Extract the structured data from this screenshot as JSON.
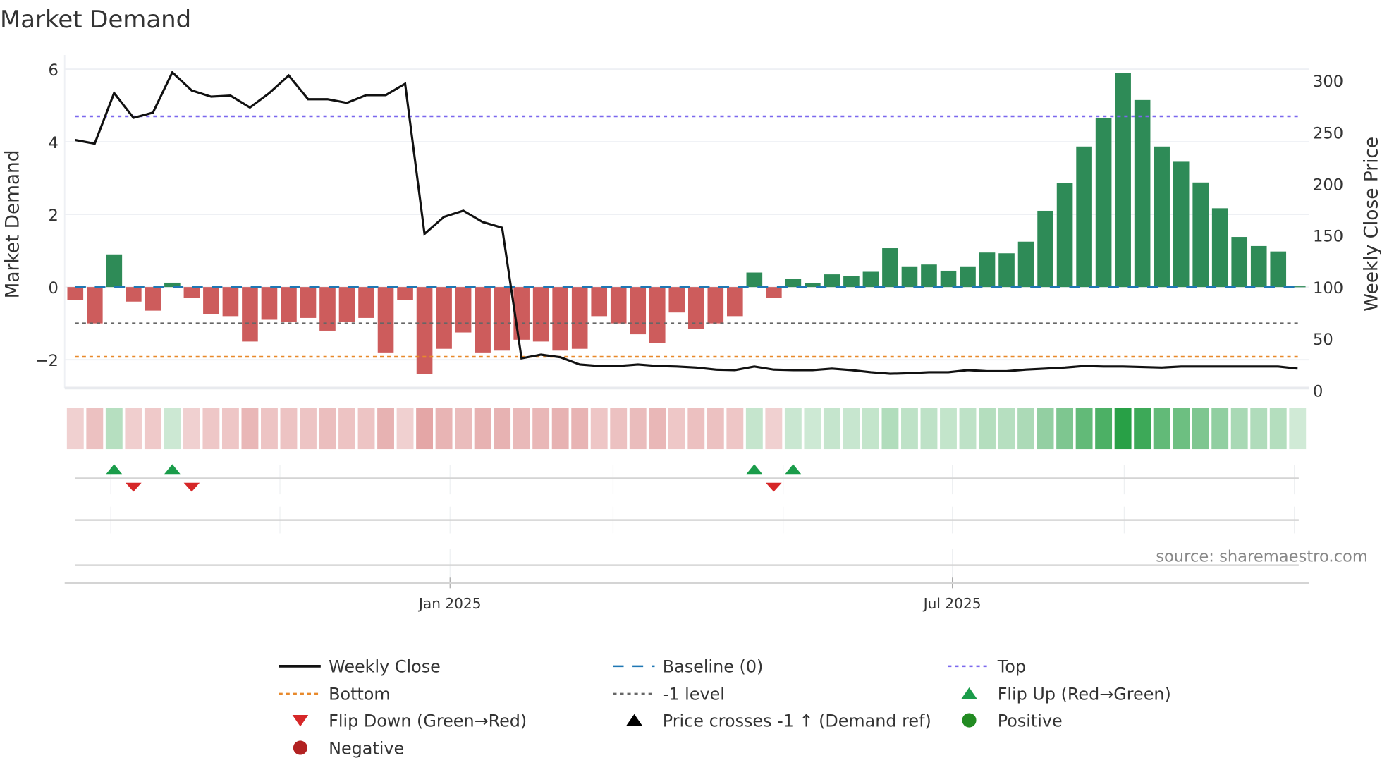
{
  "chart_data": {
    "type": "bar",
    "title": "Market Demand",
    "ylabel": "Market Demand",
    "y2label": "Weekly Close Price",
    "ylim": [
      -2.8,
      6.3
    ],
    "y2lim": [
      0,
      320
    ],
    "yticks": [
      "6",
      "4",
      "2",
      "0",
      "−2"
    ],
    "ytick_values": [
      6,
      4,
      2,
      0,
      -2
    ],
    "y2ticks": [
      "300",
      "250",
      "200",
      "150",
      "100",
      "50",
      "0"
    ],
    "y2tick_values": [
      300,
      250,
      200,
      150,
      100,
      50,
      0
    ],
    "xticks": [
      "Jan 2025",
      "Jul 2025"
    ],
    "grid": true,
    "source": "source: sharemaestro.com",
    "levels": {
      "top": 4.7,
      "bottom": -1.92,
      "minus_one": -1,
      "baseline": 0
    },
    "demand": [
      -0.35,
      -1.0,
      0.9,
      -0.4,
      -0.65,
      0.12,
      -0.3,
      -0.75,
      -0.8,
      -1.5,
      -0.9,
      -0.95,
      -0.85,
      -1.2,
      -0.95,
      -0.85,
      -1.8,
      -0.35,
      -2.4,
      -1.7,
      -1.25,
      -1.8,
      -1.75,
      -1.45,
      -1.5,
      -1.75,
      -1.7,
      -0.8,
      -1.0,
      -1.3,
      -1.55,
      -0.7,
      -1.15,
      -1.0,
      -0.8,
      0.4,
      -0.3,
      0.22,
      0.1,
      0.35,
      0.3,
      0.42,
      1.07,
      0.57,
      0.62,
      0.45,
      0.57,
      0.95,
      0.93,
      1.25,
      2.1,
      2.87,
      3.87,
      4.65,
      5.9,
      5.15,
      3.87,
      3.45,
      2.88,
      2.17,
      1.38,
      1.13,
      0.98,
      0.02
    ],
    "weekly_close": [
      242.5,
      239,
      288,
      264,
      269,
      308,
      290.5,
      284.5,
      285.5,
      274,
      288,
      305,
      282,
      282,
      278.5,
      286,
      286,
      297,
      151.5,
      168,
      174,
      163,
      157.5,
      31,
      34.5,
      32,
      25,
      23.5,
      23.5,
      25,
      23.5,
      23,
      22,
      20,
      19.5,
      23,
      20,
      19.5,
      19.5,
      21,
      19.5,
      17.5,
      16,
      16.5,
      17.5,
      17.5,
      19.5,
      18.5,
      18.5,
      20,
      21,
      22,
      23.5,
      23,
      23,
      22.5,
      22,
      23,
      23,
      23,
      23,
      23,
      23,
      21
    ],
    "flip_up_indices": [
      2,
      5,
      35,
      37
    ],
    "flip_down_indices": [
      3,
      6,
      36
    ],
    "colors": {
      "positive_bar": "#2e8b57",
      "negative_bar": "#cd5c5c",
      "line": "#111111",
      "top": "#7b68ee",
      "bottom": "#e8892b",
      "minus_one": "#666666",
      "baseline": "#1f77b4",
      "flip_up": "#1a9c4a",
      "flip_down": "#d62728",
      "positive": "#228b22",
      "negative": "#b22222"
    },
    "legend": {
      "placement": "bottom",
      "items": [
        {
          "label": "Weekly Close",
          "kind": "line"
        },
        {
          "label": "Baseline (0)",
          "kind": "dash"
        },
        {
          "label": "Top",
          "kind": "dot-top"
        },
        {
          "label": "Bottom",
          "kind": "dot-bottom"
        },
        {
          "label": "-1 level",
          "kind": "dot-minus"
        },
        {
          "label": "Flip Up (Red→Green)",
          "kind": "tri-up"
        },
        {
          "label": "Flip Down (Green→Red)",
          "kind": "tri-down"
        },
        {
          "label": "Price crosses -1 ↑ (Demand ref)",
          "kind": "tri-black"
        },
        {
          "label": "Positive",
          "kind": "dot-green"
        },
        {
          "label": "Negative",
          "kind": "dot-red"
        }
      ]
    }
  }
}
